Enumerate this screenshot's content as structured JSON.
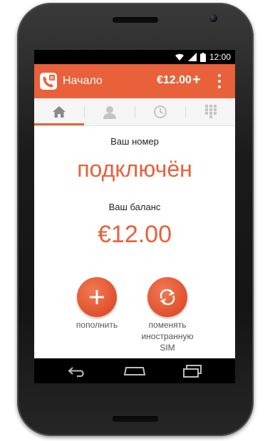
{
  "status_bar": {
    "time": "12:00",
    "icons": [
      "wifi-icon",
      "signal-icon",
      "battery-icon"
    ]
  },
  "app_bar": {
    "title": "Начало",
    "balance": "€12.00",
    "add_symbol": "+",
    "logo_icon": "phone-r-logo-icon",
    "overflow_icon": "overflow-menu-icon"
  },
  "tabs": [
    {
      "id": "home",
      "icon": "home-icon",
      "active": true
    },
    {
      "id": "contacts",
      "icon": "person-icon",
      "active": false
    },
    {
      "id": "history",
      "icon": "clock-icon",
      "active": false
    },
    {
      "id": "dialpad",
      "icon": "dialpad-icon",
      "active": false
    }
  ],
  "main": {
    "number_label": "Ваш номер",
    "number_status": "подключён",
    "balance_label": "Ваш баланс",
    "balance_value": "€12.00"
  },
  "actions": {
    "topup": {
      "label": "пополнить",
      "icon": "plus-icon"
    },
    "swap_sim": {
      "label_line1": "поменять",
      "label_line2": "иностранную",
      "label_line3": "SIM",
      "icon": "swap-arrows-icon"
    }
  },
  "colors": {
    "accent": "#e8613a",
    "app_bar": "#e8613a",
    "status_bar": "#000000",
    "nav_bar": "#000000"
  },
  "nav_bar": {
    "icons": [
      "back-icon",
      "home-nav-icon",
      "recent-apps-icon"
    ]
  }
}
